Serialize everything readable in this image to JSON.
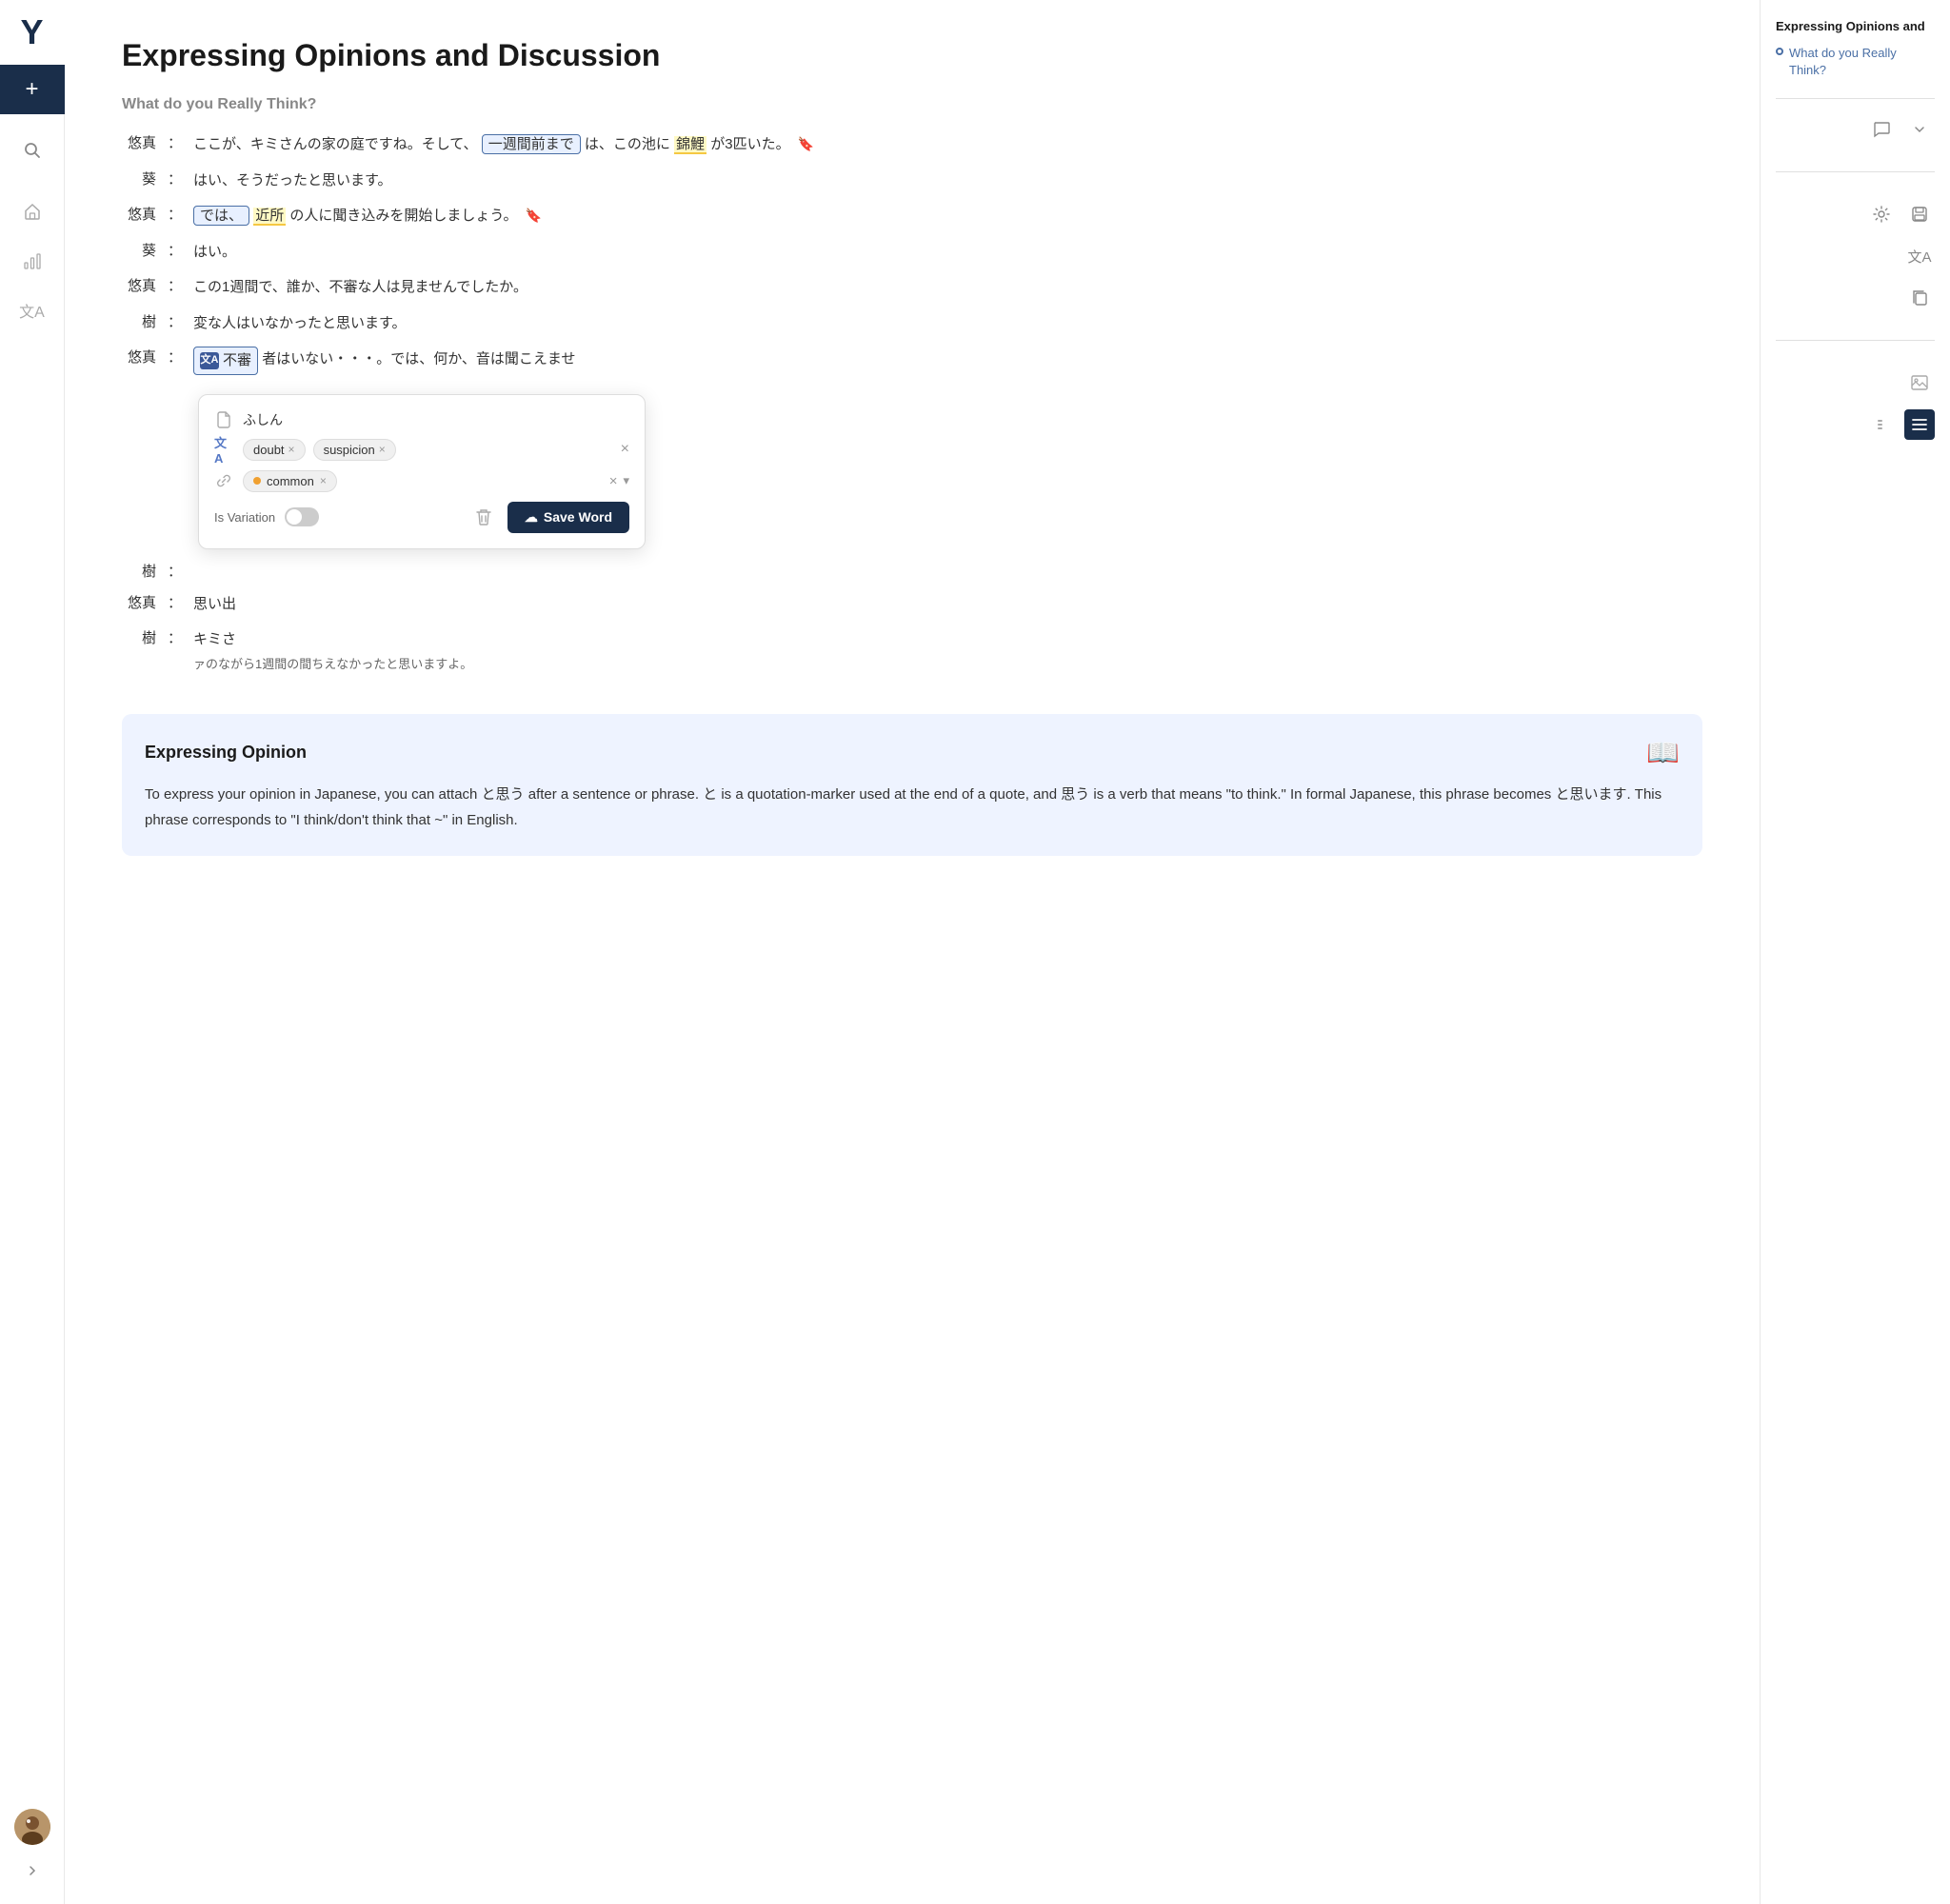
{
  "app": {
    "logo": "Y",
    "add_button_label": "+",
    "page_title": "Expressing Opinions and Discussion",
    "section_title": "What do you Really Think?"
  },
  "sidebar": {
    "nav_items": [
      {
        "name": "home",
        "icon": "⌂"
      },
      {
        "name": "chart",
        "icon": "▦"
      },
      {
        "name": "translate",
        "icon": "文A"
      }
    ]
  },
  "right_panel": {
    "title": "Expressing Opinions and",
    "link_text": "What do you Really Think?",
    "tools": [
      {
        "name": "comment",
        "icon": "💬"
      },
      {
        "name": "chevron",
        "icon": "▾"
      },
      {
        "name": "gear",
        "icon": "⚙"
      },
      {
        "name": "save",
        "icon": "💾"
      },
      {
        "name": "translate-a",
        "icon": "文A"
      },
      {
        "name": "copy",
        "icon": "⧉"
      },
      {
        "name": "image",
        "icon": "🖼"
      },
      {
        "name": "lines",
        "icon": "≡"
      },
      {
        "name": "list",
        "icon": "☰"
      }
    ]
  },
  "dialogue": [
    {
      "speaker": "悠真",
      "text_parts": [
        {
          "type": "normal",
          "text": "ここが、キミさんの家の庭ですね。そして、"
        },
        {
          "type": "highlight_box",
          "text": "一週間前まで"
        },
        {
          "type": "normal",
          "text": "は、この池に"
        },
        {
          "type": "underline_yellow",
          "text": "錦鯉"
        },
        {
          "type": "normal",
          "text": " が3匹いた。"
        },
        {
          "type": "bookmark"
        }
      ]
    },
    {
      "speaker": "葵",
      "text": "はい、そうだったと思います。"
    },
    {
      "speaker": "悠真",
      "text_parts": [
        {
          "type": "highlight_box_inline",
          "text": "では、"
        },
        {
          "type": "underline_yellow",
          "text": "近所"
        },
        {
          "type": "normal",
          "text": "の人に聞き込みを開始しましょう。"
        },
        {
          "type": "bookmark"
        }
      ]
    },
    {
      "speaker": "葵",
      "text": "はい。"
    },
    {
      "speaker": "悠真",
      "text": "この1週間で、誰か、不審な人は見ませんでしたか。"
    },
    {
      "speaker": "樹",
      "text": "変な人はいなかったと思います。"
    },
    {
      "speaker": "悠真",
      "text_popup": "不審",
      "text_after": "者はいない・・・。では、何か、音は聞こえませ",
      "has_translation_icon": true
    }
  ],
  "popup": {
    "reading": "ふしん",
    "translations": [
      "doubt",
      "suspicion"
    ],
    "tags_x_label": "×",
    "level": "common",
    "is_variation_label": "Is Variation",
    "save_button_label": "Save Word",
    "save_button_icon": "☁"
  },
  "more_dialogue": [
    {
      "speaker": "樹",
      "text": ":"
    },
    {
      "speaker": "悠真",
      "text_partial": "思い出"
    },
    {
      "speaker": "樹",
      "text_partial": "キミさ"
    }
  ],
  "continuation_text": "ァのながら1週間の間ちえなかったと思います。",
  "note": {
    "title": "Expressing Opinion",
    "icon": "📖",
    "body": "To express your opinion in Japanese, you can attach と思う after a sentence or phrase. と is a quotation-marker used at the end of a quote, and 思う is a verb that means \"to think.\" In formal Japanese, this phrase becomes と思います. This phrase corresponds to \"I think/don't think that ~\" in English."
  }
}
